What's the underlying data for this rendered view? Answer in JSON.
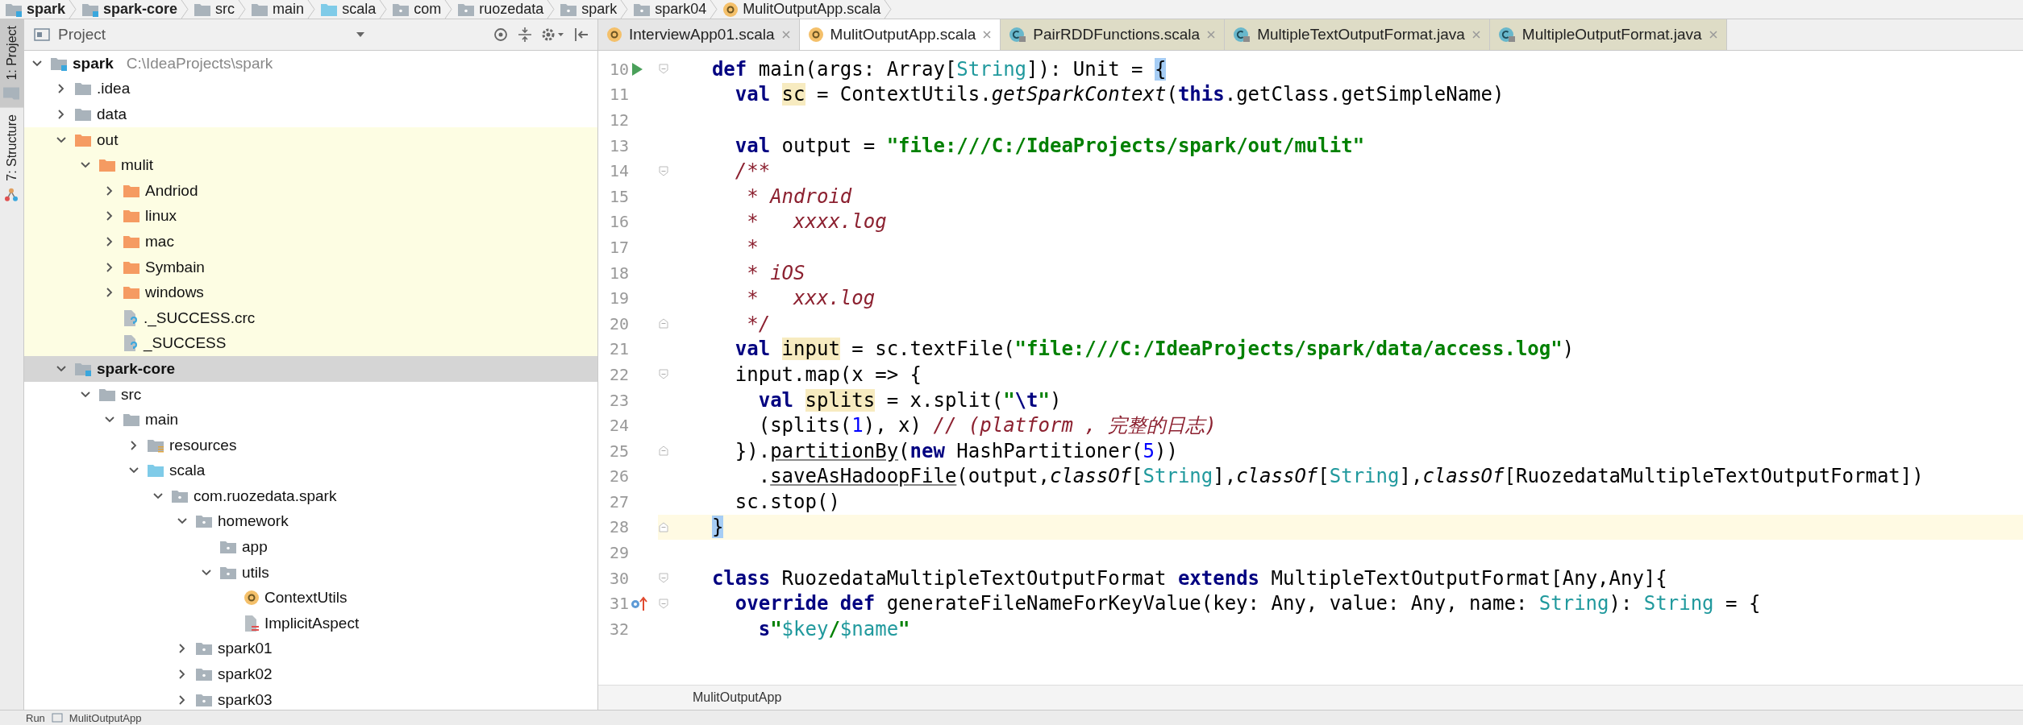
{
  "breadcrumbs": [
    {
      "label": "spark",
      "kind": "module"
    },
    {
      "label": "spark-core",
      "kind": "module"
    },
    {
      "label": "src",
      "kind": "folder"
    },
    {
      "label": "main",
      "kind": "folder"
    },
    {
      "label": "scala",
      "kind": "source"
    },
    {
      "label": "com",
      "kind": "package"
    },
    {
      "label": "ruozedata",
      "kind": "package"
    },
    {
      "label": "spark",
      "kind": "package"
    },
    {
      "label": "spark04",
      "kind": "package"
    },
    {
      "label": "MulitOutputApp.scala",
      "kind": "object"
    }
  ],
  "tool_strip": [
    {
      "label": "1: Project",
      "kind": "folder",
      "selected": true
    },
    {
      "label": "7: Structure",
      "kind": "structure",
      "selected": false
    }
  ],
  "project_panel": {
    "title": "Project",
    "tree": [
      {
        "label": "spark",
        "path": "C:\\IdeaProjects\\spark",
        "kind": "module",
        "expanded": true,
        "selected": false,
        "children": [
          {
            "label": ".idea",
            "kind": "folder",
            "expanded": false,
            "selected": false
          },
          {
            "label": "data",
            "kind": "folder",
            "expanded": false,
            "selected": false
          },
          {
            "label": "out",
            "kind": "excluded-folder",
            "excluded": true,
            "expanded": true,
            "selected": false,
            "children": [
              {
                "label": "mulit",
                "kind": "excluded-folder",
                "excluded": true,
                "expanded": true,
                "selected": false,
                "children": [
                  {
                    "label": "Andriod",
                    "kind": "excluded-folder",
                    "excluded": true,
                    "expanded": false,
                    "selected": false
                  },
                  {
                    "label": "linux",
                    "kind": "excluded-folder",
                    "excluded": true,
                    "expanded": false,
                    "selected": false
                  },
                  {
                    "label": "mac",
                    "kind": "excluded-folder",
                    "excluded": true,
                    "expanded": false,
                    "selected": false
                  },
                  {
                    "label": "Symbain",
                    "kind": "excluded-folder",
                    "excluded": true,
                    "expanded": false,
                    "selected": false
                  },
                  {
                    "label": "windows",
                    "kind": "excluded-folder",
                    "excluded": true,
                    "expanded": false,
                    "selected": false
                  },
                  {
                    "label": "._SUCCESS.crc",
                    "kind": "unknown-file",
                    "excluded": true,
                    "selected": false
                  },
                  {
                    "label": "_SUCCESS",
                    "kind": "unknown-file",
                    "excluded": true,
                    "selected": false
                  }
                ]
              }
            ]
          },
          {
            "label": "spark-core",
            "kind": "module",
            "expanded": true,
            "selected": true,
            "children": [
              {
                "label": "src",
                "kind": "folder",
                "expanded": true,
                "selected": false,
                "children": [
                  {
                    "label": "main",
                    "kind": "folder",
                    "expanded": true,
                    "selected": false,
                    "children": [
                      {
                        "label": "resources",
                        "kind": "resources",
                        "expanded": false,
                        "selected": false
                      },
                      {
                        "label": "scala",
                        "kind": "source",
                        "expanded": true,
                        "selected": false,
                        "children": [
                          {
                            "label": "com.ruozedata.spark",
                            "kind": "package",
                            "expanded": true,
                            "selected": false,
                            "children": [
                              {
                                "label": "homework",
                                "kind": "package",
                                "expanded": true,
                                "selected": false,
                                "children": [
                                  {
                                    "label": "app",
                                    "kind": "package",
                                    "selected": false
                                  },
                                  {
                                    "label": "utils",
                                    "kind": "package",
                                    "expanded": true,
                                    "selected": false,
                                    "children": [
                                      {
                                        "label": "ContextUtils",
                                        "kind": "object",
                                        "selected": false
                                      },
                                      {
                                        "label": "ImplicitAspect",
                                        "kind": "scala-file",
                                        "selected": false
                                      }
                                    ]
                                  }
                                ]
                              },
                              {
                                "label": "spark01",
                                "kind": "package",
                                "expanded": false,
                                "selected": false
                              },
                              {
                                "label": "spark02",
                                "kind": "package",
                                "expanded": false,
                                "selected": false
                              },
                              {
                                "label": "spark03",
                                "kind": "package",
                                "expanded": false,
                                "selected": false
                              }
                            ]
                          }
                        ]
                      }
                    ]
                  }
                ]
              }
            ]
          }
        ]
      }
    ]
  },
  "editor": {
    "tabs": [
      {
        "label": "InterviewApp01.scala",
        "kind": "object",
        "selected": false
      },
      {
        "label": "MulitOutputApp.scala",
        "kind": "object",
        "selected": true
      },
      {
        "label": "PairRDDFunctions.scala",
        "kind": "library-class",
        "selected": false
      },
      {
        "label": "MultipleTextOutputFormat.java",
        "kind": "library-class",
        "selected": false
      },
      {
        "label": "MultipleOutputFormat.java",
        "kind": "library-class",
        "selected": false
      }
    ],
    "lines": [
      {
        "number": "10",
        "marker": {
          "kind": "run"
        },
        "fold": {
          "kind": "start"
        },
        "current": false,
        "tokens": [
          {
            "text": "  def",
            "kind": "kw"
          },
          {
            "text": " main(args: Array[",
            "kind": "plain"
          },
          {
            "text": "String",
            "kind": "type"
          },
          {
            "text": "]): Unit = ",
            "kind": "plain"
          },
          {
            "text": "{",
            "kind": "brace"
          }
        ]
      },
      {
        "number": "11",
        "current": false,
        "tokens": [
          {
            "text": "    val ",
            "kind": "kw"
          },
          {
            "text": "sc",
            "kind": "hl"
          },
          {
            "text": " = ContextUtils.",
            "kind": "plain"
          },
          {
            "text": "getSparkContext",
            "kind": "italic"
          },
          {
            "text": "(",
            "kind": "plain"
          },
          {
            "text": "this",
            "kind": "kw"
          },
          {
            "text": ".getClass.getSimpleName)",
            "kind": "plain"
          }
        ]
      },
      {
        "number": "12",
        "current": false
      },
      {
        "number": "13",
        "current": false,
        "tokens": [
          {
            "text": "    val",
            "kind": "kw"
          },
          {
            "text": " output = ",
            "kind": "plain"
          },
          {
            "text": "\"file:///C:/IdeaProjects/spark/out/mulit\"",
            "kind": "str"
          }
        ]
      },
      {
        "number": "14",
        "fold": {
          "kind": "start"
        },
        "current": false,
        "tokens": [
          {
            "text": "    /**",
            "kind": "comment"
          }
        ]
      },
      {
        "number": "15",
        "current": false,
        "tokens": [
          {
            "text": "     * Android",
            "kind": "comment"
          }
        ]
      },
      {
        "number": "16",
        "current": false,
        "tokens": [
          {
            "text": "     *   xxxx.log",
            "kind": "comment"
          }
        ]
      },
      {
        "number": "17",
        "current": false,
        "tokens": [
          {
            "text": "     *",
            "kind": "comment"
          }
        ]
      },
      {
        "number": "18",
        "current": false,
        "tokens": [
          {
            "text": "     * iOS",
            "kind": "comment"
          }
        ]
      },
      {
        "number": "19",
        "current": false,
        "tokens": [
          {
            "text": "     *   xxx.log",
            "kind": "comment"
          }
        ]
      },
      {
        "number": "20",
        "fold": {
          "kind": "end"
        },
        "current": false,
        "tokens": [
          {
            "text": "     */",
            "kind": "comment"
          }
        ]
      },
      {
        "number": "21",
        "current": false,
        "tokens": [
          {
            "text": "    val ",
            "kind": "kw"
          },
          {
            "text": "input",
            "kind": "hl"
          },
          {
            "text": " = sc.textFile(",
            "kind": "plain"
          },
          {
            "text": "\"file:///C:/IdeaProjects/spark/data/access.log\"",
            "kind": "str"
          },
          {
            "text": ")",
            "kind": "plain"
          }
        ]
      },
      {
        "number": "22",
        "fold": {
          "kind": "start"
        },
        "current": false,
        "tokens": [
          {
            "text": "    input.map(x => {",
            "kind": "plain"
          }
        ]
      },
      {
        "number": "23",
        "current": false,
        "tokens": [
          {
            "text": "      val ",
            "kind": "kw"
          },
          {
            "text": "splits",
            "kind": "hl"
          },
          {
            "text": " = x.split(",
            "kind": "plain"
          },
          {
            "text": "\"",
            "kind": "str"
          },
          {
            "text": "\\t",
            "kind": "esc"
          },
          {
            "text": "\"",
            "kind": "str"
          },
          {
            "text": ")",
            "kind": "plain"
          }
        ]
      },
      {
        "number": "24",
        "current": false,
        "tokens": [
          {
            "text": "      (splits(",
            "kind": "plain"
          },
          {
            "text": "1",
            "kind": "num"
          },
          {
            "text": "), x) ",
            "kind": "plain"
          },
          {
            "text": "// (platform , 完整的日志)",
            "kind": "comment"
          }
        ]
      },
      {
        "number": "25",
        "fold": {
          "kind": "end"
        },
        "current": false,
        "tokens": [
          {
            "text": "    }).",
            "kind": "plain"
          },
          {
            "text": "partitionBy",
            "kind": "under"
          },
          {
            "text": "(",
            "kind": "plain"
          },
          {
            "text": "new",
            "kind": "kw"
          },
          {
            "text": " HashPartitioner(",
            "kind": "plain"
          },
          {
            "text": "5",
            "kind": "num"
          },
          {
            "text": "))",
            "kind": "plain"
          }
        ]
      },
      {
        "number": "26",
        "current": false,
        "tokens": [
          {
            "text": "      .",
            "kind": "plain"
          },
          {
            "text": "saveAsHadoopFile",
            "kind": "under"
          },
          {
            "text": "(output,",
            "kind": "plain"
          },
          {
            "text": "classOf",
            "kind": "italic"
          },
          {
            "text": "[",
            "kind": "plain"
          },
          {
            "text": "String",
            "kind": "type"
          },
          {
            "text": "],",
            "kind": "plain"
          },
          {
            "text": "classOf",
            "kind": "italic"
          },
          {
            "text": "[",
            "kind": "plain"
          },
          {
            "text": "String",
            "kind": "type"
          },
          {
            "text": "],",
            "kind": "plain"
          },
          {
            "text": "classOf",
            "kind": "italic"
          },
          {
            "text": "[RuozedataMultipleTextOutputFormat])",
            "kind": "plain"
          }
        ]
      },
      {
        "number": "27",
        "current": false,
        "tokens": [
          {
            "text": "    sc.stop()",
            "kind": "plain"
          }
        ]
      },
      {
        "number": "28",
        "fold": {
          "kind": "end"
        },
        "current": true,
        "tokens": [
          {
            "text": "  }",
            "kind": "brace"
          }
        ]
      },
      {
        "number": "29",
        "current": false
      },
      {
        "number": "30",
        "fold": {
          "kind": "start"
        },
        "current": false,
        "tokens": [
          {
            "text": "  class",
            "kind": "kw"
          },
          {
            "text": " RuozedataMultipleTextOutputFormat ",
            "kind": "plain"
          },
          {
            "text": "extends",
            "kind": "kw"
          },
          {
            "text": " MultipleTextOutputFormat[Any,Any]{",
            "kind": "plain"
          }
        ]
      },
      {
        "number": "31",
        "marker": {
          "kind": "override"
        },
        "fold": {
          "kind": "start"
        },
        "current": false,
        "tokens": [
          {
            "text": "    override def",
            "kind": "kw"
          },
          {
            "text": " generateFileNameForKeyValue(key: Any, value: Any, name: ",
            "kind": "plain"
          },
          {
            "text": "String",
            "kind": "type"
          },
          {
            "text": "): ",
            "kind": "plain"
          },
          {
            "text": "String",
            "kind": "type"
          },
          {
            "text": " = {",
            "kind": "plain"
          }
        ]
      },
      {
        "number": "32",
        "current": false,
        "tokens": [
          {
            "text": "      s",
            "kind": "kw"
          },
          {
            "text": "\"",
            "kind": "str"
          },
          {
            "text": "$key",
            "kind": "type"
          },
          {
            "text": "/",
            "kind": "str"
          },
          {
            "text": "$name",
            "kind": "type"
          },
          {
            "text": "\"",
            "kind": "str"
          }
        ]
      }
    ],
    "footer": "MulitOutputApp"
  },
  "bottom_bar": {
    "label": "Run",
    "tab": "MulitOutputApp"
  }
}
